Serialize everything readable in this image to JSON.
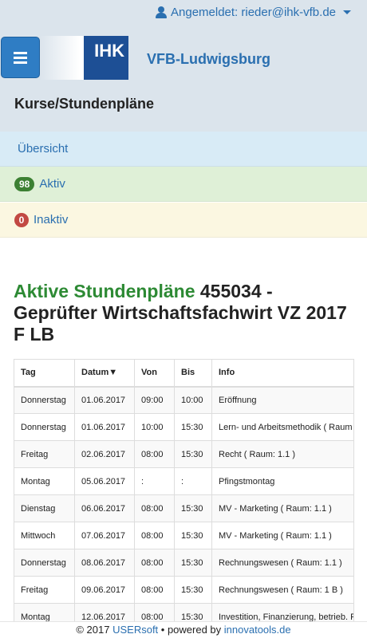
{
  "header": {
    "login_text": "Angemeldet: rieder@ihk-vfb.de",
    "logo_text": "IHK",
    "brand": "VFB-Ludwigsburg",
    "page_title": "Kurse/Stundenpläne"
  },
  "nav": {
    "overview": "Übersicht",
    "active_count": "98",
    "active_label": "Aktiv",
    "inactive_count": "0",
    "inactive_label": "Inaktiv"
  },
  "section": {
    "title_green": "Aktive Stundenpläne",
    "title_rest": " 455034 - Geprüfter Wirtschaftsfachwirt VZ 2017 F LB"
  },
  "table": {
    "headers": [
      "Tag",
      "Datum▼",
      "Von",
      "Bis",
      "Info"
    ],
    "rows": [
      [
        "Donnerstag",
        "01.06.2017",
        "09:00",
        "10:00",
        "Eröffnung"
      ],
      [
        "Donnerstag",
        "01.06.2017",
        "10:00",
        "15:30",
        "Lern- und Arbeitsmethodik ( Raum"
      ],
      [
        "Freitag",
        "02.06.2017",
        "08:00",
        "15:30",
        "Recht ( Raum: 1.1 )"
      ],
      [
        "Montag",
        "05.06.2017",
        ":",
        ":",
        "Pfingstmontag"
      ],
      [
        "Dienstag",
        "06.06.2017",
        "08:00",
        "15:30",
        "MV - Marketing ( Raum: 1.1 )"
      ],
      [
        "Mittwoch",
        "07.06.2017",
        "08:00",
        "15:30",
        "MV - Marketing ( Raum: 1.1 )"
      ],
      [
        "Donnerstag",
        "08.06.2017",
        "08:00",
        "15:30",
        "Rechnungswesen ( Raum: 1.1 )"
      ],
      [
        "Freitag",
        "09.06.2017",
        "08:00",
        "15:30",
        "Rechnungswesen ( Raum: 1 B )"
      ],
      [
        "Montag",
        "12.06.2017",
        "08:00",
        "15:30",
        "Investition, Finanzierung, betrieb. Re"
      ]
    ]
  },
  "footer": {
    "copyright": "© 2017 ",
    "company": "USERsoft",
    "separator": " • powered by ",
    "powered": "innovatools.de"
  },
  "colors": {
    "accent": "#2a6fb0",
    "header_bg": "#dbe4ec",
    "active_green": "#2d8a34",
    "badge_green": "#3c8033",
    "badge_red": "#c24943"
  },
  "icons": {
    "menu": "hamburger-icon",
    "user": "user-icon",
    "caret": "caret-down-icon"
  }
}
